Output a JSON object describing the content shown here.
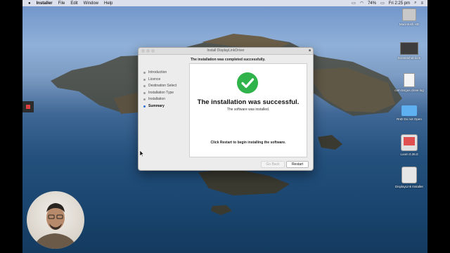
{
  "menubar": {
    "apple": "",
    "app_name": "Installer",
    "menus": [
      "File",
      "Edit",
      "Window",
      "Help"
    ],
    "battery": "74%",
    "clock": "Fri 2:25 pm"
  },
  "desktop_icons": [
    {
      "label": "Macintosh HD",
      "icon": "hard-drive-icon"
    },
    {
      "label": "Screenshot-icon",
      "icon": "image-icon"
    },
    {
      "label": "com.targus.clone.log",
      "icon": "document-icon"
    },
    {
      "label": "RnD Do not Open",
      "icon": "folder-icon"
    },
    {
      "label": "Loom 0.36.0",
      "icon": "disk-image-icon"
    },
    {
      "label": "DisplayLink Installer",
      "icon": "disk-image-icon"
    }
  ],
  "window": {
    "title": "Install DisplayLinkDriver",
    "headline": "The installation was completed successfully.",
    "steps": [
      {
        "label": "Introduction",
        "active": false
      },
      {
        "label": "Licence",
        "active": false
      },
      {
        "label": "Destination Select",
        "active": false
      },
      {
        "label": "Installation Type",
        "active": false
      },
      {
        "label": "Installation",
        "active": false
      },
      {
        "label": "Summary",
        "active": true
      }
    ],
    "success_title": "The installation was successful.",
    "success_subtitle": "The software was installed.",
    "restart_note": "Click Restart to begin installing the software.",
    "buttons": {
      "go_back": "Go Back",
      "restart": "Restart"
    }
  },
  "colors": {
    "accent": "#2b6fd6",
    "success": "#2fb34a"
  }
}
